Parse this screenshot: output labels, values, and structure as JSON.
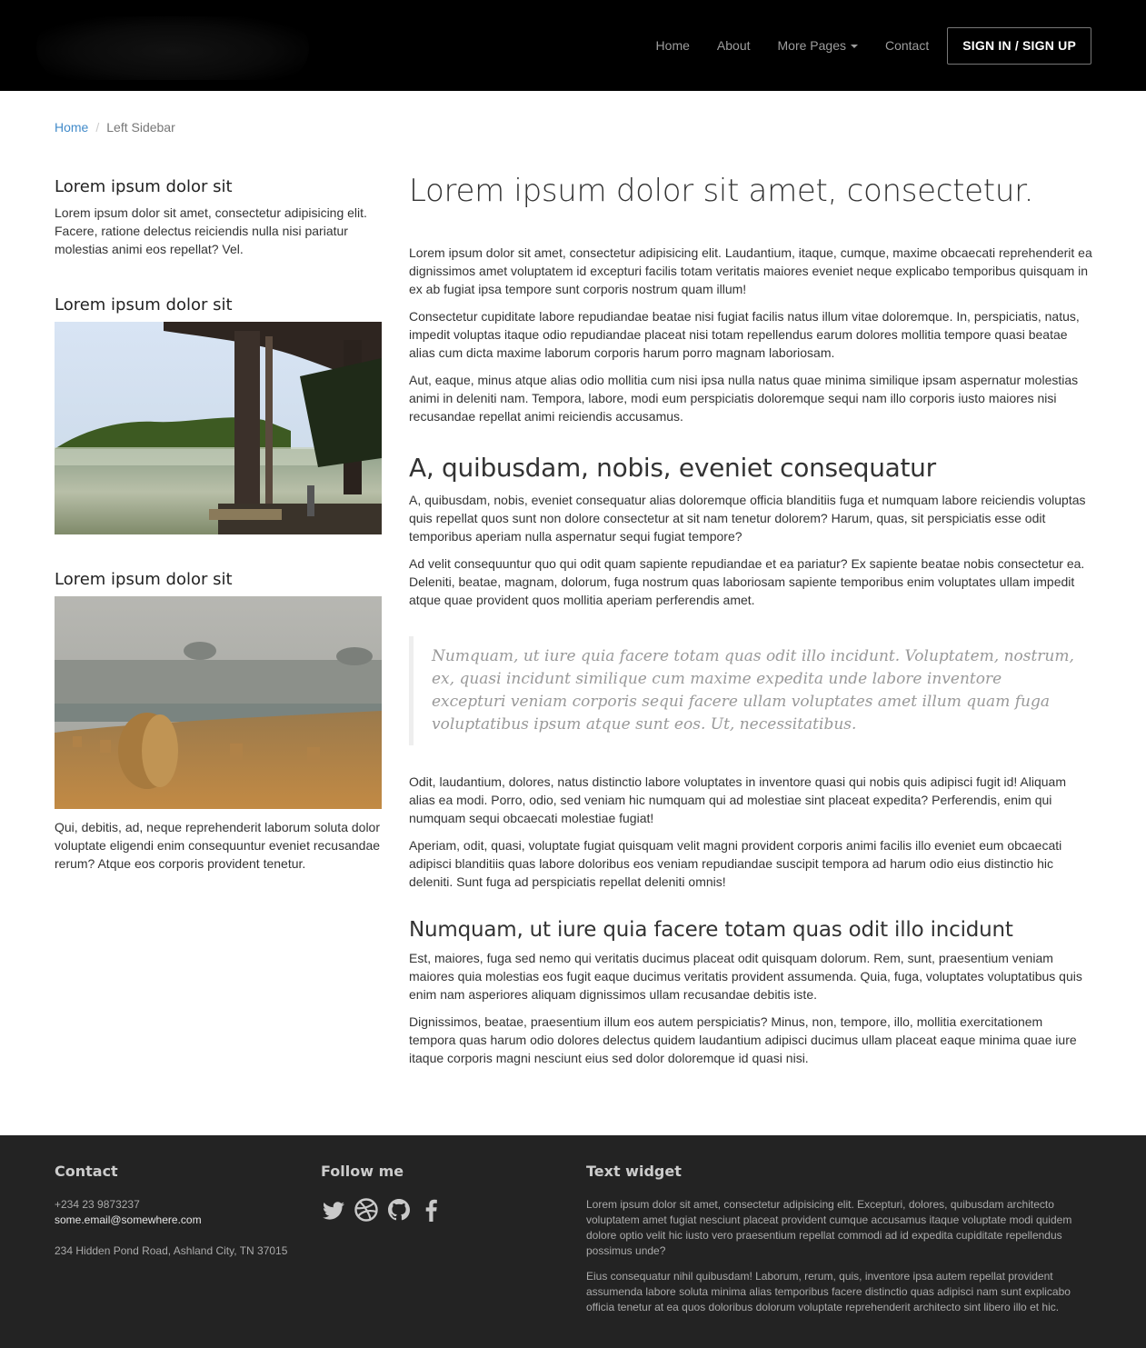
{
  "nav": {
    "items": [
      "Home",
      "About",
      "More Pages",
      "Contact"
    ],
    "signin": "SIGN IN / SIGN UP"
  },
  "breadcrumb": {
    "home": "Home",
    "current": "Left Sidebar"
  },
  "sidebar": {
    "widgets": [
      {
        "title": "Lorem ipsum dolor sit",
        "text": "Lorem ipsum dolor sit amet, consectetur adipisicing elit. Facere, ratione delectus reiciendis nulla nisi pariatur molestias animi eos repellat? Vel."
      },
      {
        "title": "Lorem ipsum dolor sit",
        "image": "dock-lake-fog-image"
      },
      {
        "title": "Lorem ipsum dolor sit",
        "image": "hay-bales-field-image",
        "text": "Qui, debitis, ad, neque reprehenderit laborum soluta dolor voluptate eligendi enim consequuntur eveniet recusandae rerum? Atque eos corporis provident tenetur."
      }
    ]
  },
  "main": {
    "title": "Lorem ipsum dolor sit amet, consectetur.",
    "intro": [
      "Lorem ipsum dolor sit amet, consectetur adipisicing elit. Laudantium, itaque, cumque, maxime obcaecati reprehenderit ea dignissimos amet voluptatem id excepturi facilis totam veritatis maiores eveniet neque explicabo temporibus quisquam in ex ab fugiat ipsa tempore sunt corporis nostrum quam illum!",
      "Consectetur cupiditate labore repudiandae beatae nisi fugiat facilis natus illum vitae doloremque. In, perspiciatis, natus, impedit voluptas itaque odio repudiandae placeat nisi totam repellendus earum dolores mollitia tempore quasi beatae alias cum dicta maxime laborum corporis harum porro magnam laboriosam.",
      "Aut, eaque, minus atque alias odio mollitia cum nisi ipsa nulla natus quae minima similique ipsam aspernatur molestias animi in deleniti nam. Tempora, labore, modi eum perspiciatis doloremque sequi nam illo corporis iusto maiores nisi recusandae repellat animi reiciendis accusamus."
    ],
    "h2": "A, quibusdam, nobis, eveniet consequatur",
    "section2": [
      "A, quibusdam, nobis, eveniet consequatur alias doloremque officia blanditiis fuga et numquam labore reiciendis voluptas quis repellat quos sunt non dolore consectetur at sit nam tenetur dolorem? Harum, quas, sit perspiciatis esse odit temporibus aperiam nulla aspernatur sequi fugiat tempore?",
      "Ad velit consequuntur quo qui odit quam sapiente repudiandae et ea pariatur? Ex sapiente beatae nobis consectetur ea. Deleniti, beatae, magnam, dolorum, fuga nostrum quas laboriosam sapiente temporibus enim voluptates ullam impedit atque quae provident quos mollitia aperiam perferendis amet."
    ],
    "quote": "Numquam, ut iure quia facere totam quas odit illo incidunt. Voluptatem, nostrum, ex, quasi incidunt similique cum maxime expedita unde labore inventore excepturi veniam corporis sequi facere ullam voluptates amet illum quam fuga voluptatibus ipsum atque sunt eos. Ut, necessitatibus.",
    "after_quote": [
      "Odit, laudantium, dolores, natus distinctio labore voluptates in inventore quasi qui nobis quis adipisci fugit id! Aliquam alias ea modi. Porro, odio, sed veniam hic numquam qui ad molestiae sint placeat expedita? Perferendis, enim qui numquam sequi obcaecati molestiae fugiat!",
      "Aperiam, odit, quasi, voluptate fugiat quisquam velit magni provident corporis animi facilis illo eveniet eum obcaecati adipisci blanditiis quas labore doloribus eos veniam repudiandae suscipit tempora ad harum odio eius distinctio hic deleniti. Sunt fuga ad perspiciatis repellat deleniti omnis!"
    ],
    "h3": "Numquam, ut iure quia facere totam quas odit illo incidunt",
    "section3": [
      "Est, maiores, fuga sed nemo qui veritatis ducimus placeat odit quisquam dolorum. Rem, sunt, praesentium veniam maiores quia molestias eos fugit eaque ducimus veritatis provident assumenda. Quia, fuga, voluptates voluptatibus quis enim nam asperiores aliquam dignissimos ullam recusandae debitis iste.",
      "Dignissimos, beatae, praesentium illum eos autem perspiciatis? Minus, non, tempore, illo, mollitia exercitationem tempora quas harum odio dolores delectus quidem laudantium adipisci ducimus ullam placeat eaque minima quae iure itaque corporis magni nesciunt eius sed dolor doloremque id quasi nisi."
    ]
  },
  "footer": {
    "contact": {
      "title": "Contact",
      "phone": "+234 23 9873237",
      "email": "some.email@somewhere.com",
      "address": "234 Hidden Pond Road, Ashland City, TN 37015"
    },
    "follow": {
      "title": "Follow me",
      "icons": [
        "twitter-icon",
        "dribbble-icon",
        "github-icon",
        "facebook-icon"
      ]
    },
    "widget": {
      "title": "Text widget",
      "paragraphs": [
        "Lorem ipsum dolor sit amet, consectetur adipisicing elit. Excepturi, dolores, quibusdam architecto voluptatem amet fugiat nesciunt placeat provident cumque accusamus itaque voluptate modi quidem dolore optio velit hic iusto vero praesentium repellat commodi ad id expedita cupiditate repellendus possimus unde?",
        "Eius consequatur nihil quibusdam! Laborum, rerum, quis, inventore ipsa autem repellat provident assumenda labore soluta minima alias temporibus facere distinctio quas adipisci nam sunt explicabo officia tenetur at ea quos doloribus dolorum voluptate reprehenderit architecto sint libero illo et hic."
      ]
    }
  }
}
